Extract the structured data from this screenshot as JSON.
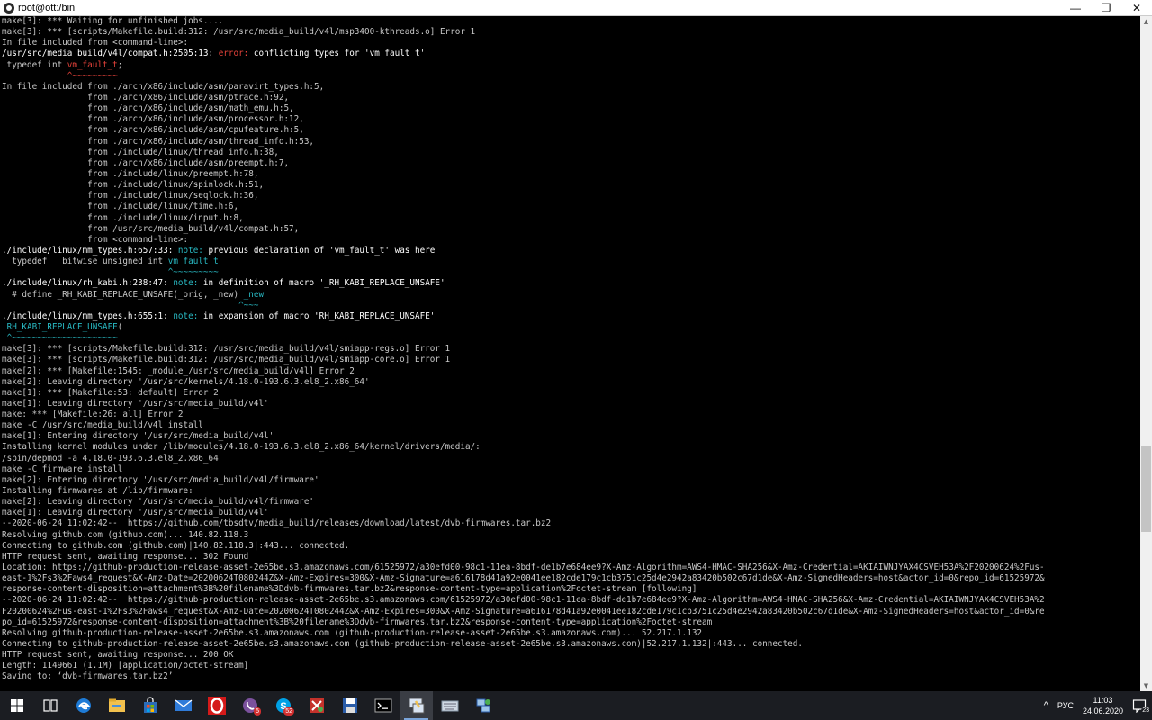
{
  "window": {
    "title": "root@ott:/bin"
  },
  "colors": {
    "text": "#c8c8c8",
    "error": "#e5423a",
    "note": "#28b8c2",
    "tilde": "#3fb24a",
    "warn_quote": "#d0d0d0"
  },
  "terminal_lines": [
    [
      {
        "t": "make[3]: *** Waiting for unfinished jobs...."
      }
    ],
    [
      {
        "t": "make[3]: *** [scripts/Makefile.build:312: /usr/src/media_build/v4l/msp3400-kthreads.o] Error 1"
      }
    ],
    [
      {
        "t": "In file included from <command-line>:"
      }
    ],
    [
      {
        "t": "/usr/src/media_build/v4l/compat.h:2505:13: ",
        "c": "#ffffff"
      },
      {
        "t": "error:",
        "c": "#e5423a"
      },
      {
        "t": " conflicting types for '",
        "c": "#ffffff"
      },
      {
        "t": "vm_fault_t",
        "c": "#ffffff"
      },
      {
        "t": "'",
        "c": "#ffffff"
      }
    ],
    [
      {
        "t": " typedef int "
      },
      {
        "t": "vm_fault_t",
        "c": "#e5423a"
      },
      {
        "t": ";"
      }
    ],
    [
      {
        "t": "             ^~~~~~~~~~",
        "c": "#e5423a"
      }
    ],
    [
      {
        "t": "In file included from ./arch/x86/include/asm/paravirt_types.h:5,"
      }
    ],
    [
      {
        "t": "                 from ./arch/x86/include/asm/ptrace.h:92,"
      }
    ],
    [
      {
        "t": "                 from ./arch/x86/include/asm/math_emu.h:5,"
      }
    ],
    [
      {
        "t": "                 from ./arch/x86/include/asm/processor.h:12,"
      }
    ],
    [
      {
        "t": "                 from ./arch/x86/include/asm/cpufeature.h:5,"
      }
    ],
    [
      {
        "t": "                 from ./arch/x86/include/asm/thread_info.h:53,"
      }
    ],
    [
      {
        "t": "                 from ./include/linux/thread_info.h:38,"
      }
    ],
    [
      {
        "t": "                 from ./arch/x86/include/asm/preempt.h:7,"
      }
    ],
    [
      {
        "t": "                 from ./include/linux/preempt.h:78,"
      }
    ],
    [
      {
        "t": "                 from ./include/linux/spinlock.h:51,"
      }
    ],
    [
      {
        "t": "                 from ./include/linux/seqlock.h:36,"
      }
    ],
    [
      {
        "t": "                 from ./include/linux/time.h:6,"
      }
    ],
    [
      {
        "t": "                 from ./include/linux/input.h:8,"
      }
    ],
    [
      {
        "t": "                 from /usr/src/media_build/v4l/compat.h:57,"
      }
    ],
    [
      {
        "t": "                 from <command-line>:"
      }
    ],
    [
      {
        "t": "./include/linux/mm_types.h:657:33: ",
        "c": "#ffffff"
      },
      {
        "t": "note:",
        "c": "#28b8c2"
      },
      {
        "t": " previous declaration of '",
        "c": "#ffffff"
      },
      {
        "t": "vm_fault_t",
        "c": "#ffffff"
      },
      {
        "t": "' was here",
        "c": "#ffffff"
      }
    ],
    [
      {
        "t": "  typedef __bitwise unsigned int "
      },
      {
        "t": "vm_fault_t",
        "c": "#28b8c2"
      }
    ],
    [
      {
        "t": "                                 ^~~~~~~~~~",
        "c": "#28b8c2"
      }
    ],
    [
      {
        "t": "./include/linux/rh_kabi.h:238:47: ",
        "c": "#ffffff"
      },
      {
        "t": "note:",
        "c": "#28b8c2"
      },
      {
        "t": " in definition of macro '",
        "c": "#ffffff"
      },
      {
        "t": "_RH_KABI_REPLACE_UNSAFE",
        "c": "#ffffff"
      },
      {
        "t": "'",
        "c": "#ffffff"
      }
    ],
    [
      {
        "t": "  # define _RH_KABI_REPLACE_UNSAFE(_orig, _new) "
      },
      {
        "t": "_new",
        "c": "#28b8c2"
      }
    ],
    [
      {
        "t": "                                               ^~~~",
        "c": "#28b8c2"
      }
    ],
    [
      {
        "t": "./include/linux/mm_types.h:655:1: ",
        "c": "#ffffff"
      },
      {
        "t": "note:",
        "c": "#28b8c2"
      },
      {
        "t": " in expansion of macro '",
        "c": "#ffffff"
      },
      {
        "t": "RH_KABI_REPLACE_UNSAFE",
        "c": "#ffffff"
      },
      {
        "t": "'",
        "c": "#ffffff"
      }
    ],
    [
      {
        "t": " "
      },
      {
        "t": "RH_KABI_REPLACE_UNSAFE",
        "c": "#28b8c2"
      },
      {
        "t": "("
      }
    ],
    [
      {
        "t": " ^~~~~~~~~~~~~~~~~~~~~~",
        "c": "#28b8c2"
      }
    ],
    [
      {
        "t": "make[3]: *** [scripts/Makefile.build:312: /usr/src/media_build/v4l/smiapp-regs.o] Error 1"
      }
    ],
    [
      {
        "t": "make[3]: *** [scripts/Makefile.build:312: /usr/src/media_build/v4l/smiapp-core.o] Error 1"
      }
    ],
    [
      {
        "t": "make[2]: *** [Makefile:1545: _module_/usr/src/media_build/v4l] Error 2"
      }
    ],
    [
      {
        "t": "make[2]: Leaving directory '/usr/src/kernels/4.18.0-193.6.3.el8_2.x86_64'"
      }
    ],
    [
      {
        "t": "make[1]: *** [Makefile:53: default] Error 2"
      }
    ],
    [
      {
        "t": "make[1]: Leaving directory '/usr/src/media_build/v4l'"
      }
    ],
    [
      {
        "t": "make: *** [Makefile:26: all] Error 2"
      }
    ],
    [
      {
        "t": "make -C /usr/src/media_build/v4l install"
      }
    ],
    [
      {
        "t": "make[1]: Entering directory '/usr/src/media_build/v4l'"
      }
    ],
    [
      {
        "t": "Installing kernel modules under /lib/modules/4.18.0-193.6.3.el8_2.x86_64/kernel/drivers/media/:"
      }
    ],
    [
      {
        "t": "/sbin/depmod -a 4.18.0-193.6.3.el8_2.x86_64"
      }
    ],
    [
      {
        "t": "make -C firmware install"
      }
    ],
    [
      {
        "t": "make[2]: Entering directory '/usr/src/media_build/v4l/firmware'"
      }
    ],
    [
      {
        "t": "Installing firmwares at /lib/firmware:"
      }
    ],
    [
      {
        "t": "make[2]: Leaving directory '/usr/src/media_build/v4l/firmware'"
      }
    ],
    [
      {
        "t": "make[1]: Leaving directory '/usr/src/media_build/v4l'"
      }
    ],
    [
      {
        "t": "--2020-06-24 11:02:42--  https://github.com/tbsdtv/media_build/releases/download/latest/dvb-firmwares.tar.bz2"
      }
    ],
    [
      {
        "t": "Resolving github.com (github.com)... 140.82.118.3"
      }
    ],
    [
      {
        "t": "Connecting to github.com (github.com)|140.82.118.3|:443... connected."
      }
    ],
    [
      {
        "t": "HTTP request sent, awaiting response... 302 Found"
      }
    ],
    [
      {
        "t": "Location: https://github-production-release-asset-2e65be.s3.amazonaws.com/61525972/a30efd00-98c1-11ea-8bdf-de1b7e684ee9?X-Amz-Algorithm=AWS4-HMAC-SHA256&X-Amz-Credential=AKIAIWNJYAX4CSVEH53A%2F20200624%2Fus-"
      }
    ],
    [
      {
        "t": "east-1%2Fs3%2Faws4_request&X-Amz-Date=20200624T080244Z&X-Amz-Expires=300&X-Amz-Signature=a616178d41a92e0041ee182cde179c1cb3751c25d4e2942a83420b502c67d1de&X-Amz-SignedHeaders=host&actor_id=0&repo_id=61525972&"
      }
    ],
    [
      {
        "t": "response-content-disposition=attachment%3B%20filename%3Ddvb-firmwares.tar.bz2&response-content-type=application%2Foctet-stream [following]"
      }
    ],
    [
      {
        "t": "--2020-06-24 11:02:42--  https://github-production-release-asset-2e65be.s3.amazonaws.com/61525972/a30efd00-98c1-11ea-8bdf-de1b7e684ee9?X-Amz-Algorithm=AWS4-HMAC-SHA256&X-Amz-Credential=AKIAIWNJYAX4CSVEH53A%2"
      }
    ],
    [
      {
        "t": "F20200624%2Fus-east-1%2Fs3%2Faws4_request&X-Amz-Date=20200624T080244Z&X-Amz-Expires=300&X-Amz-Signature=a616178d41a92e0041ee182cde179c1cb3751c25d4e2942a83420b502c67d1de&X-Amz-SignedHeaders=host&actor_id=0&re"
      }
    ],
    [
      {
        "t": "po_id=61525972&response-content-disposition=attachment%3B%20filename%3Ddvb-firmwares.tar.bz2&response-content-type=application%2Foctet-stream"
      }
    ],
    [
      {
        "t": "Resolving github-production-release-asset-2e65be.s3.amazonaws.com (github-production-release-asset-2e65be.s3.amazonaws.com)... 52.217.1.132"
      }
    ],
    [
      {
        "t": "Connecting to github-production-release-asset-2e65be.s3.amazonaws.com (github-production-release-asset-2e65be.s3.amazonaws.com)|52.217.1.132|:443... connected."
      }
    ],
    [
      {
        "t": "HTTP request sent, awaiting response... 200 OK"
      }
    ],
    [
      {
        "t": "Length: 1149661 (1.1M) [application/octet-stream]"
      }
    ],
    [
      {
        "t": "Saving to: ‘dvb-firmwares.tar.bz2’"
      }
    ]
  ],
  "taskbar": {
    "apps": [
      {
        "icon": "windows-start-icon"
      },
      {
        "icon": "task-view-icon"
      },
      {
        "icon": "edge-browser-icon"
      },
      {
        "icon": "file-explorer-icon"
      },
      {
        "icon": "store-icon"
      },
      {
        "icon": "mail-icon"
      },
      {
        "icon": "opera-icon"
      },
      {
        "icon": "viber-icon",
        "badge": "5"
      },
      {
        "icon": "skype-icon",
        "badge": "52"
      },
      {
        "icon": "network-tool-icon"
      },
      {
        "icon": "save-disk-icon"
      },
      {
        "icon": "terminal-icon"
      },
      {
        "icon": "putty-icon",
        "active": true
      },
      {
        "icon": "keyboard-icon"
      },
      {
        "icon": "network-connections-icon"
      }
    ],
    "tray": {
      "chevron": "^",
      "lang": "РУС",
      "time": "11:03",
      "date": "24.06.2020",
      "notif_count": "23"
    }
  }
}
